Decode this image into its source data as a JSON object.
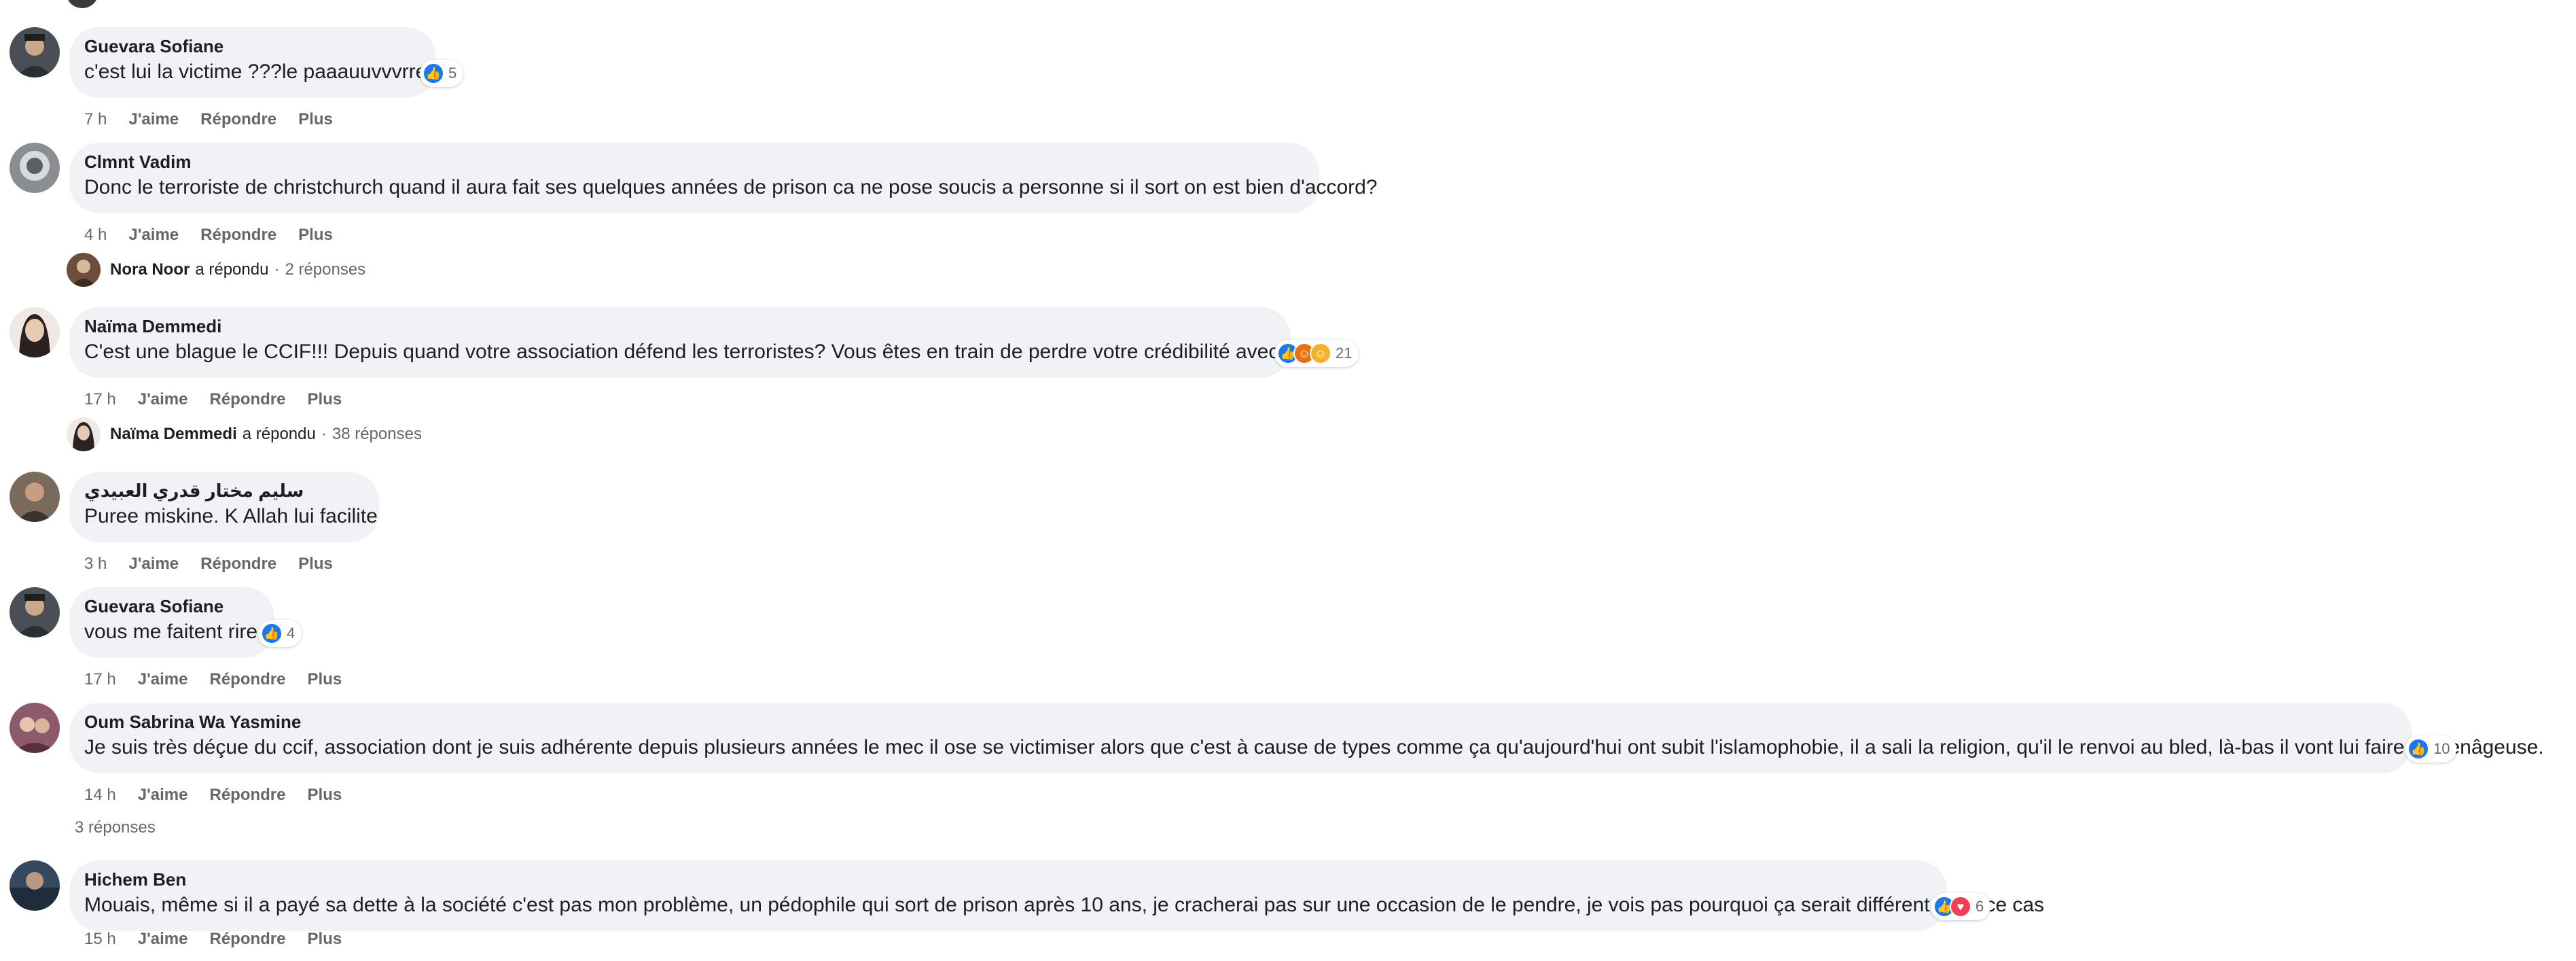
{
  "ui": {
    "like_label": "J'aime",
    "reply_label": "Répondre",
    "more_label": "Plus",
    "replied_verb": "a répondu",
    "separator": "·"
  },
  "colors": {
    "bubble_bg": "#f0f2f5",
    "like_blue": "#1877f2",
    "angry_orange": "#e9710f",
    "haha_yellow": "#f7b125",
    "love_red": "#f33e58",
    "muted_text": "#65676b"
  },
  "comments": [
    {
      "author": "Guevara Sofiane",
      "text": "c'est lui la victime ???le paaauuvvvrre!!",
      "reactions": [
        "like-icon"
      ],
      "reaction_count": "5",
      "time": "7 h"
    },
    {
      "author": "Clmnt Vadim",
      "text": "Donc le terroriste de christchurch quand il aura fait ses quelques années de prison ca ne pose soucis a personne si il sort on est bien d'accord?",
      "reactions": [],
      "reaction_count": "",
      "time": "4 h"
    },
    {
      "author": "Naïma Demmedi",
      "text": "C'est une blague le CCIF!!! Depuis quand votre association défend les terroristes? Vous êtes en train de perdre votre crédibilité avec ce cas.",
      "reactions": [
        "like-icon",
        "angry-icon",
        "haha-icon"
      ],
      "reaction_count": "21",
      "time": "17 h"
    },
    {
      "author": "سليم مختار قدري العبيدي",
      "text": "Puree miskine. K Allah lui facilite",
      "reactions": [],
      "reaction_count": "",
      "time": "3 h"
    },
    {
      "author": "Guevara Sofiane",
      "text": "vous me faitent rire !",
      "reactions": [
        "like-icon"
      ],
      "reaction_count": "4",
      "time": "17 h"
    },
    {
      "author": "Oum Sabrina Wa Yasmine",
      "text": "Je suis très déçue du ccif, association dont je suis adhérente depuis plusieurs années le mec il ose se victimiser alors que c'est à cause de types comme ça qu'aujourd'hui ont subit l'islamophobie, il a sali la religion, qu'il le renvoi au bled, là-bas il vont lui faire moyenâgeuse.",
      "reactions": [
        "like-icon"
      ],
      "reaction_count": "10",
      "time": "14 h"
    },
    {
      "author": "Hichem Ben",
      "text": "Mouais, même si il a payé sa dette à la société c'est pas mon problème, un pédophile qui sort de prison après 10 ans, je cracherai pas sur une occasion de le pendre, je vois pas pourquoi ça serait différent dans ce cas",
      "reactions": [
        "like-icon",
        "love-icon"
      ],
      "reaction_count": "6",
      "time": "15 h"
    }
  ],
  "reply_summaries": [
    {
      "name": "Nora Noor",
      "count": "2 réponses"
    },
    {
      "name": "Naïma Demmedi",
      "count": "38 réponses"
    }
  ],
  "more_replies": "3 réponses"
}
